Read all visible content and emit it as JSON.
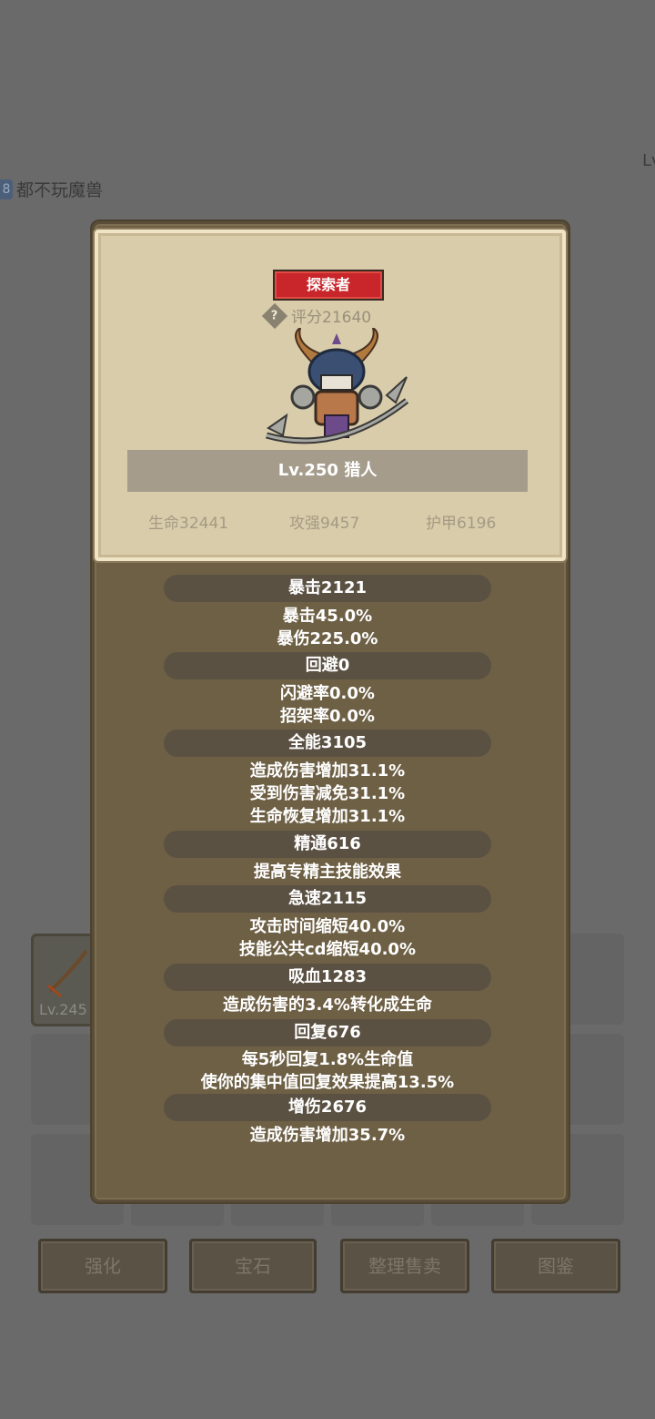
{
  "background": {
    "top_right_text": "Lv",
    "player_level_badge": "8",
    "player_name": "都不玩魔兽",
    "equipped_item_level": "Lv.245",
    "buttons": [
      "强化",
      "宝石",
      "整理售卖",
      "图鉴"
    ]
  },
  "hero": {
    "class_badge": "探索者",
    "score": "评分21640",
    "name": "Lv.250 猎人",
    "stats": {
      "hp": "生命32441",
      "attack": "攻强9457",
      "armor": "护甲6196"
    }
  },
  "sections": [
    {
      "header": "暴击2121",
      "lines": [
        "暴击45.0%",
        "暴伤225.0%"
      ]
    },
    {
      "header": "回避0",
      "lines": [
        "闪避率0.0%",
        "招架率0.0%"
      ]
    },
    {
      "header": "全能3105",
      "lines": [
        "造成伤害增加31.1%",
        "受到伤害减免31.1%",
        "生命恢复增加31.1%"
      ]
    },
    {
      "header": "精通616",
      "lines": [
        "提高专精主技能效果"
      ]
    },
    {
      "header": "急速2115",
      "lines": [
        "攻击时间缩短40.0%",
        "技能公共cd缩短40.0%"
      ]
    },
    {
      "header": "吸血1283",
      "lines": [
        "造成伤害的3.4%转化成生命"
      ]
    },
    {
      "header": "回复676",
      "lines": [
        "每5秒回复1.8%生命值",
        "使你的集中值回复效果提高13.5%"
      ]
    },
    {
      "header": "增伤2676",
      "lines": [
        "造成伤害增加35.7%"
      ]
    }
  ],
  "colors": {
    "badge_red": "#c8262b",
    "panel_brown": "#6e6045",
    "card_parchment": "#d9ccaa"
  }
}
